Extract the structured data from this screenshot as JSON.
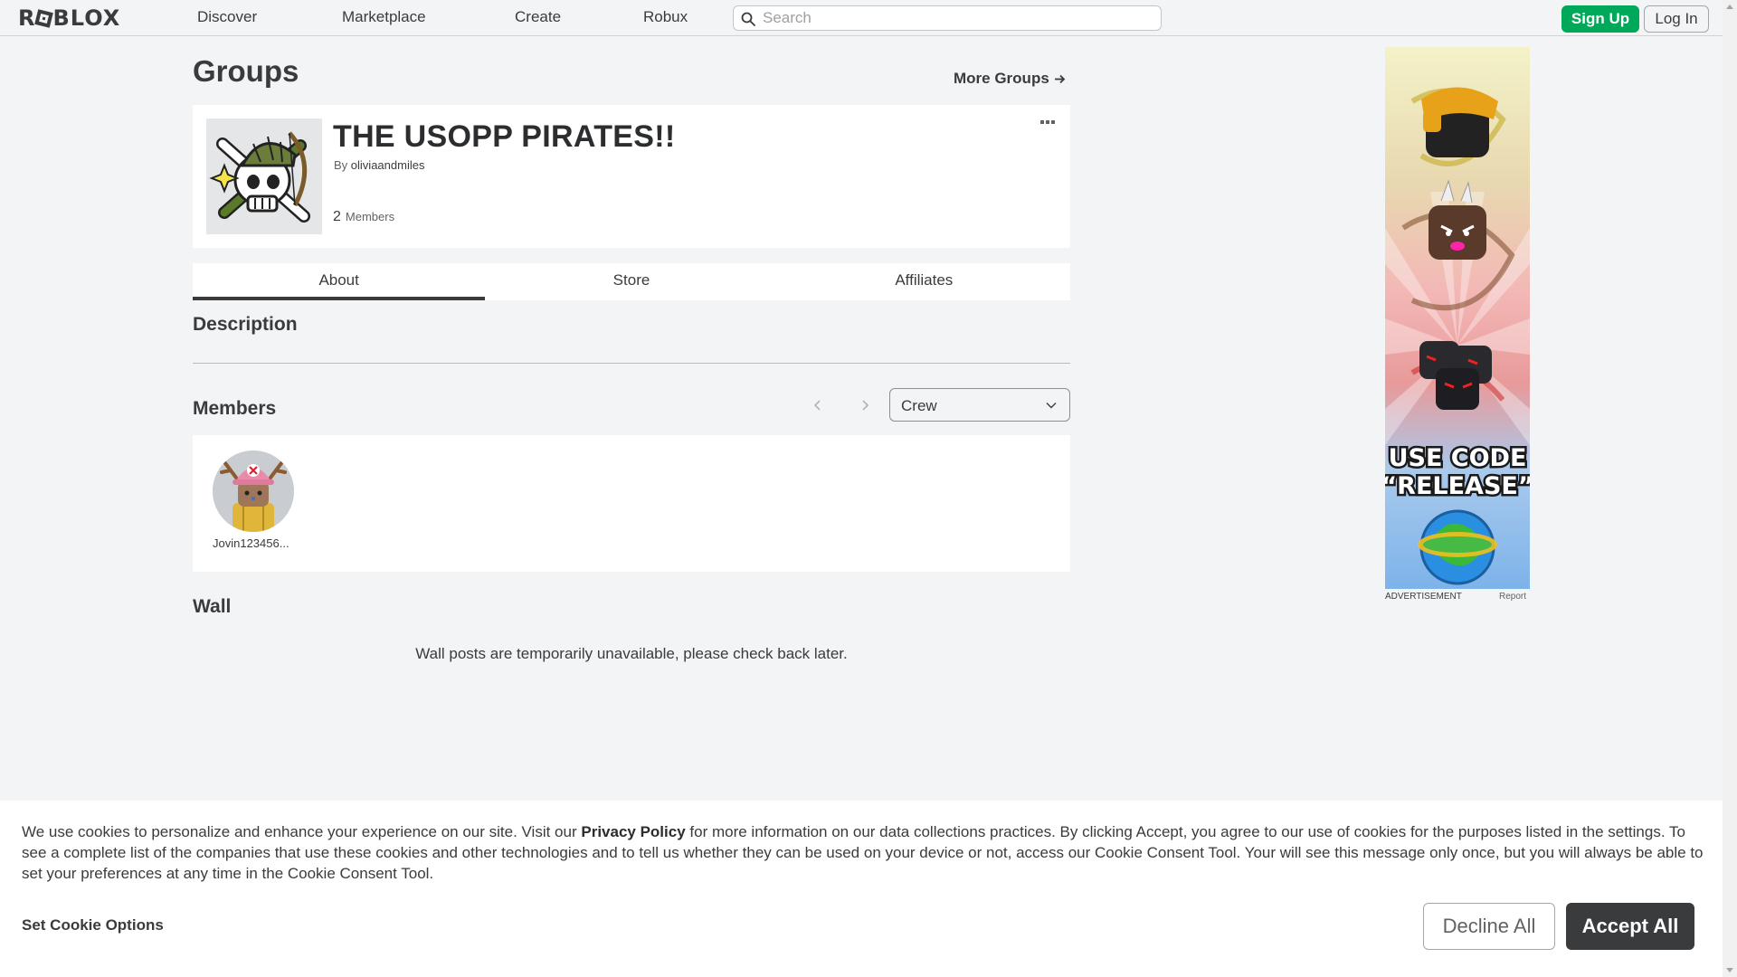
{
  "nav": {
    "logo_text": "ROBLOX",
    "links": [
      "Discover",
      "Marketplace",
      "Create",
      "Robux"
    ],
    "search_placeholder": "Search",
    "signup_label": "Sign Up",
    "login_label": "Log In"
  },
  "page": {
    "title": "Groups",
    "more_groups_label": "More Groups"
  },
  "group": {
    "name": "THE USOPP PIRATES!!",
    "by_label": "By",
    "owner": "oliviaandmiles",
    "member_count": "2",
    "members_label": "Members"
  },
  "tabs": [
    "About",
    "Store",
    "Affiliates"
  ],
  "about": {
    "description_title": "Description",
    "members_title": "Members",
    "role_selected": "Crew",
    "members": [
      {
        "name": "Jovin123456..."
      }
    ],
    "wall_title": "Wall",
    "wall_message": "Wall posts are temporarily unavailable, please check back later."
  },
  "ad": {
    "code_line1": "USE CODE",
    "code_line2": "“RELEASE”",
    "label": "ADVERTISEMENT",
    "report_label": "Report"
  },
  "cookie": {
    "text_before": "We use cookies to personalize and enhance your experience on our site. Visit our ",
    "privacy_link": "Privacy Policy",
    "text_after": " for more information on our data collections practices. By clicking Accept, you agree to our use of cookies for the purposes listed in the settings. To see a complete list of the companies that use these cookies and other technologies and to tell us whether they can be used on your device or not, access our Cookie Consent Tool. Your will see this message only once, but you will always be able to set your preferences at any time in the Cookie Consent Tool.",
    "options_label": "Set Cookie Options",
    "decline_label": "Decline All",
    "accept_label": "Accept All"
  },
  "colors": {
    "signup_green": "#00a85a",
    "page_bg": "#f2f4f5",
    "accept_dark": "#393b3d"
  }
}
